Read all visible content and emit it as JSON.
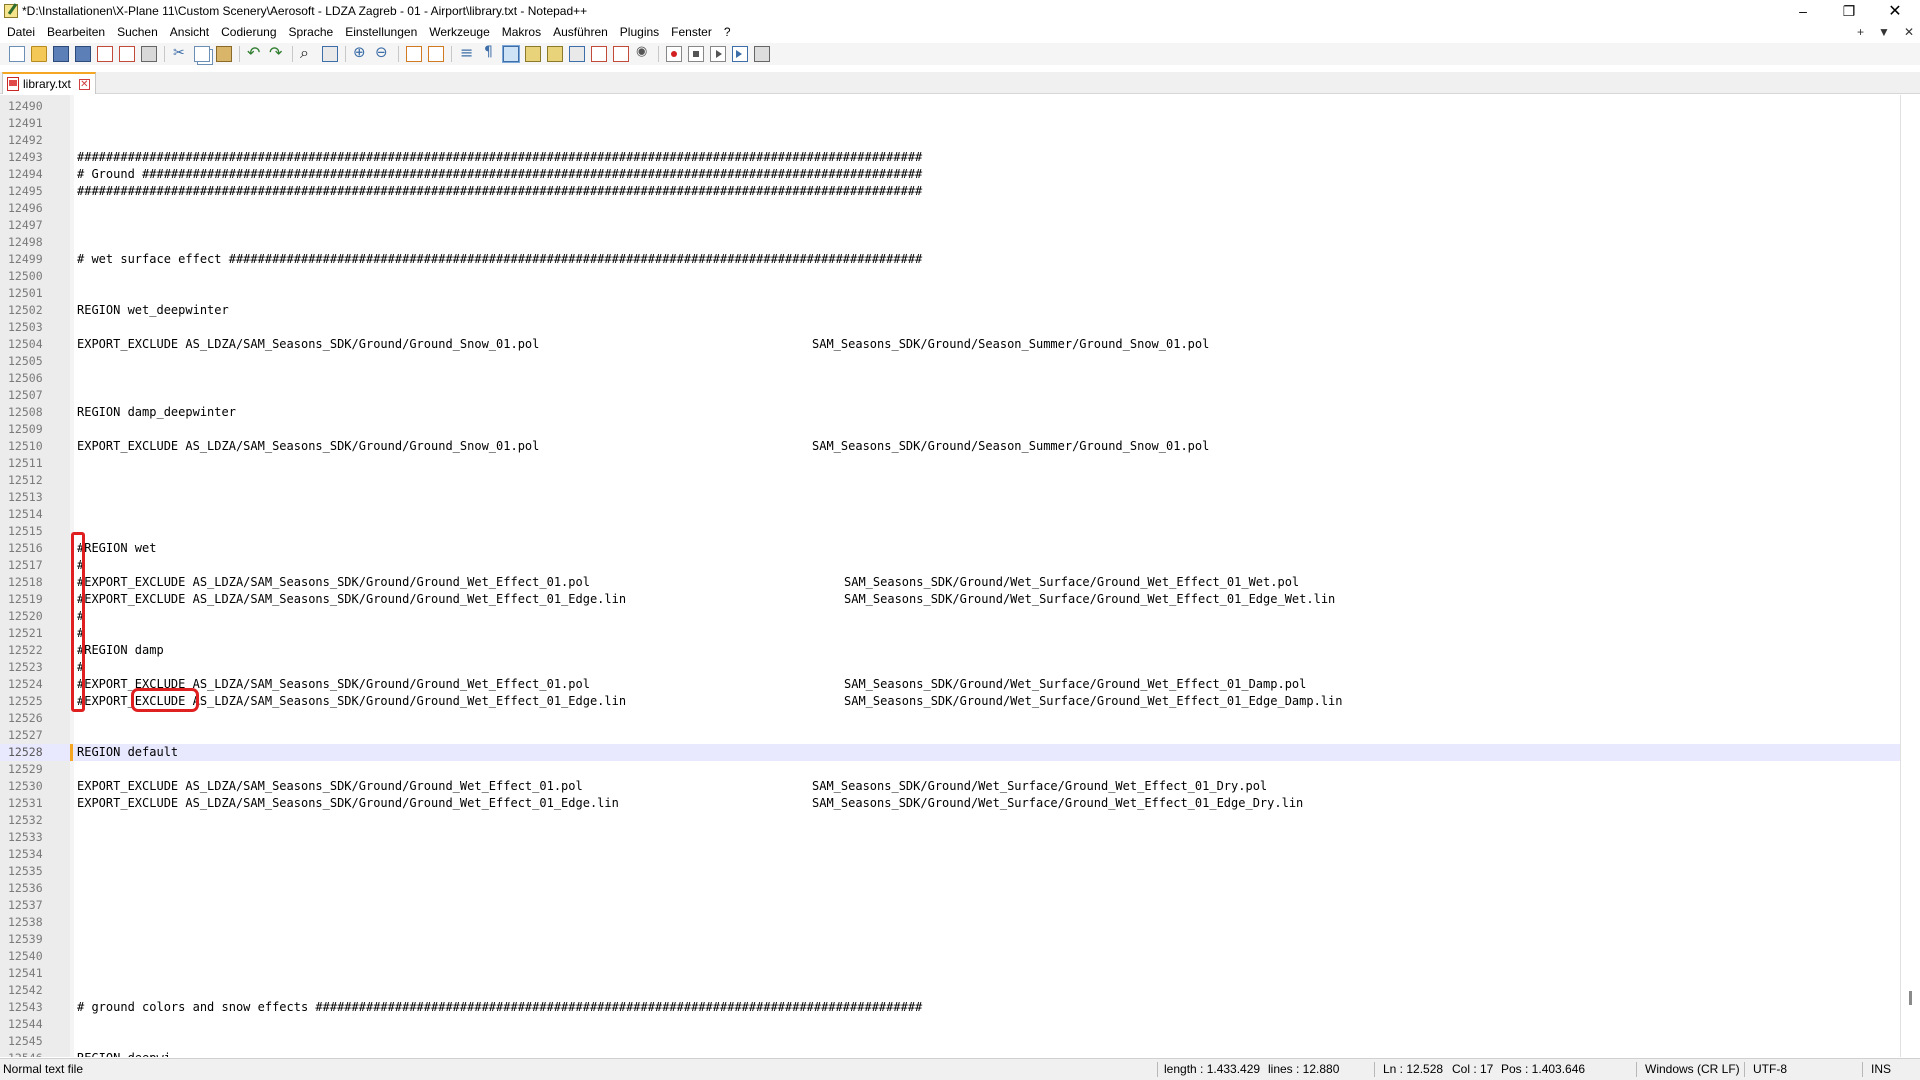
{
  "window": {
    "title": "*D:\\Installationen\\X-Plane 11\\Custom Scenery\\Aerosoft - LDZA Zagreb - 01 - Airport\\library.txt - Notepad++",
    "minimize": "–",
    "restore": "❐",
    "close": "✕"
  },
  "menu": {
    "items": [
      "Datei",
      "Bearbeiten",
      "Suchen",
      "Ansicht",
      "Codierung",
      "Sprache",
      "Einstellungen",
      "Werkzeuge",
      "Makros",
      "Ausführen",
      "Plugins",
      "Fenster",
      "?"
    ],
    "right_plus": "+",
    "right_down": "▼",
    "right_close": "✕"
  },
  "tab": {
    "label": "library.txt"
  },
  "editor": {
    "lines": [
      {
        "n": "12490",
        "t": "",
        "t2": ""
      },
      {
        "n": "12491",
        "t": "",
        "t2": ""
      },
      {
        "n": "12492",
        "t": "",
        "t2": ""
      },
      {
        "n": "12493",
        "t": "#####################################################################################################################",
        "t2": ""
      },
      {
        "n": "12494",
        "t": "# Ground ############################################################################################################",
        "t2": ""
      },
      {
        "n": "12495",
        "t": "#####################################################################################################################",
        "t2": ""
      },
      {
        "n": "12496",
        "t": "",
        "t2": ""
      },
      {
        "n": "12497",
        "t": "",
        "t2": ""
      },
      {
        "n": "12498",
        "t": "",
        "t2": ""
      },
      {
        "n": "12499",
        "t": "# wet surface effect ################################################################################################",
        "t2": ""
      },
      {
        "n": "12500",
        "t": "",
        "t2": ""
      },
      {
        "n": "12501",
        "t": "",
        "t2": ""
      },
      {
        "n": "12502",
        "t": "REGION wet_deepwinter",
        "t2": ""
      },
      {
        "n": "12503",
        "t": "",
        "t2": ""
      },
      {
        "n": "12504",
        "t": "EXPORT_EXCLUDE AS_LDZA/SAM_Seasons_SDK/Ground/Ground_Snow_01.pol",
        "t2": "SAM_Seasons_SDK/Ground/Season_Summer/Ground_Snow_01.pol",
        "c2": 812
      },
      {
        "n": "12505",
        "t": "",
        "t2": ""
      },
      {
        "n": "12506",
        "t": "",
        "t2": ""
      },
      {
        "n": "12507",
        "t": "",
        "t2": ""
      },
      {
        "n": "12508",
        "t": "REGION damp_deepwinter",
        "t2": ""
      },
      {
        "n": "12509",
        "t": "",
        "t2": ""
      },
      {
        "n": "12510",
        "t": "EXPORT_EXCLUDE AS_LDZA/SAM_Seasons_SDK/Ground/Ground_Snow_01.pol",
        "t2": "SAM_Seasons_SDK/Ground/Season_Summer/Ground_Snow_01.pol",
        "c2": 812
      },
      {
        "n": "12511",
        "t": "",
        "t2": ""
      },
      {
        "n": "12512",
        "t": "",
        "t2": ""
      },
      {
        "n": "12513",
        "t": "",
        "t2": ""
      },
      {
        "n": "12514",
        "t": "",
        "t2": ""
      },
      {
        "n": "12515",
        "t": "",
        "t2": ""
      },
      {
        "n": "12516",
        "t": "#REGION wet",
        "t2": ""
      },
      {
        "n": "12517",
        "t": "#",
        "t2": ""
      },
      {
        "n": "12518",
        "t": "#EXPORT_EXCLUDE AS_LDZA/SAM_Seasons_SDK/Ground/Ground_Wet_Effect_01.pol",
        "t2": "SAM_Seasons_SDK/Ground/Wet_Surface/Ground_Wet_Effect_01_Wet.pol",
        "c2": 844
      },
      {
        "n": "12519",
        "t": "#EXPORT_EXCLUDE AS_LDZA/SAM_Seasons_SDK/Ground/Ground_Wet_Effect_01_Edge.lin",
        "t2": "SAM_Seasons_SDK/Ground/Wet_Surface/Ground_Wet_Effect_01_Edge_Wet.lin",
        "c2": 844
      },
      {
        "n": "12520",
        "t": "#",
        "t2": ""
      },
      {
        "n": "12521",
        "t": "#",
        "t2": ""
      },
      {
        "n": "12522",
        "t": "#REGION damp",
        "t2": ""
      },
      {
        "n": "12523",
        "t": "#",
        "t2": ""
      },
      {
        "n": "12524",
        "t": "#EXPORT_EXCLUDE AS_LDZA/SAM_Seasons_SDK/Ground/Ground_Wet_Effect_01.pol",
        "t2": "SAM_Seasons_SDK/Ground/Wet_Surface/Ground_Wet_Effect_01_Damp.pol",
        "c2": 844
      },
      {
        "n": "12525",
        "t": "#EXPORT_EXCLUDE AS_LDZA/SAM_Seasons_SDK/Ground/Ground_Wet_Effect_01_Edge.lin",
        "t2": "SAM_Seasons_SDK/Ground/Wet_Surface/Ground_Wet_Effect_01_Edge_Damp.lin",
        "c2": 844
      },
      {
        "n": "12526",
        "t": "",
        "t2": ""
      },
      {
        "n": "12527",
        "t": "",
        "t2": ""
      },
      {
        "n": "12528",
        "t": "REGION default",
        "t2": "",
        "current": true
      },
      {
        "n": "12529",
        "t": "",
        "t2": ""
      },
      {
        "n": "12530",
        "t": "EXPORT_EXCLUDE AS_LDZA/SAM_Seasons_SDK/Ground/Ground_Wet_Effect_01.pol",
        "t2": "SAM_Seasons_SDK/Ground/Wet_Surface/Ground_Wet_Effect_01_Dry.pol",
        "c2": 812
      },
      {
        "n": "12531",
        "t": "EXPORT_EXCLUDE AS_LDZA/SAM_Seasons_SDK/Ground/Ground_Wet_Effect_01_Edge.lin",
        "t2": "SAM_Seasons_SDK/Ground/Wet_Surface/Ground_Wet_Effect_01_Edge_Dry.lin",
        "c2": 812
      },
      {
        "n": "12532",
        "t": "",
        "t2": ""
      },
      {
        "n": "12533",
        "t": "",
        "t2": ""
      },
      {
        "n": "12534",
        "t": "",
        "t2": ""
      },
      {
        "n": "12535",
        "t": "",
        "t2": ""
      },
      {
        "n": "12536",
        "t": "",
        "t2": ""
      },
      {
        "n": "12537",
        "t": "",
        "t2": ""
      },
      {
        "n": "12538",
        "t": "",
        "t2": ""
      },
      {
        "n": "12539",
        "t": "",
        "t2": ""
      },
      {
        "n": "12540",
        "t": "",
        "t2": ""
      },
      {
        "n": "12541",
        "t": "",
        "t2": ""
      },
      {
        "n": "12542",
        "t": "",
        "t2": ""
      },
      {
        "n": "12543",
        "t": "# ground colors and snow effects ####################################################################################",
        "t2": ""
      },
      {
        "n": "12544",
        "t": "",
        "t2": ""
      },
      {
        "n": "12545",
        "t": "",
        "t2": ""
      },
      {
        "n": "12546",
        "t": "REGION deepwi",
        "t2": ""
      }
    ]
  },
  "status": {
    "file_type": "Normal text file",
    "length": "length : 1.433.429",
    "lines": "lines : 12.880",
    "ln": "Ln : 12.528",
    "col": "Col : 17",
    "pos": "Pos : 1.403.646",
    "eol": "Windows (CR LF)",
    "encoding": "UTF-8",
    "mode": "INS"
  },
  "colors": {
    "annotation": "#e02020",
    "current_line": "#e8e8ff",
    "tab_accent": "#f5a623"
  }
}
